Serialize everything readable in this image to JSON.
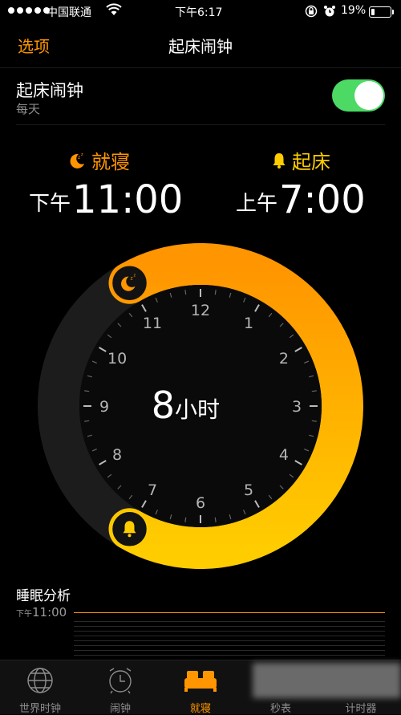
{
  "status": {
    "carrier": "中国联通",
    "time": "下午6:17",
    "battery": "19%",
    "battery_level": 0.19
  },
  "nav": {
    "options_label": "选项",
    "title": "起床闹钟"
  },
  "alarm": {
    "title": "起床闹钟",
    "subtitle": "每天",
    "enabled": true
  },
  "bedtime": {
    "label": "就寝",
    "ampm": "下午",
    "time": "11:00"
  },
  "wake": {
    "label": "起床",
    "ampm": "上午",
    "time": "7:00"
  },
  "clock": {
    "numbers": [
      "12",
      "1",
      "2",
      "3",
      "4",
      "5",
      "6",
      "7",
      "8",
      "9",
      "10",
      "11"
    ],
    "duration_value": "8",
    "duration_unit": "小时",
    "bedtime_hour": 23,
    "wake_hour": 7
  },
  "analysis": {
    "title": "睡眠分析",
    "label_ampm": "下午",
    "label_time": "11:00"
  },
  "tabs": [
    {
      "label": "世界时钟",
      "icon": "globe-icon"
    },
    {
      "label": "闹钟",
      "icon": "alarm-clock-icon"
    },
    {
      "label": "就寝",
      "icon": "bed-icon",
      "active": true
    },
    {
      "label": "秒表",
      "icon": "stopwatch-icon"
    },
    {
      "label": "计时器",
      "icon": "timer-icon"
    }
  ],
  "colors": {
    "accent": "#ff9500",
    "wake": "#ffcc00",
    "toggle_on": "#4cd964"
  }
}
